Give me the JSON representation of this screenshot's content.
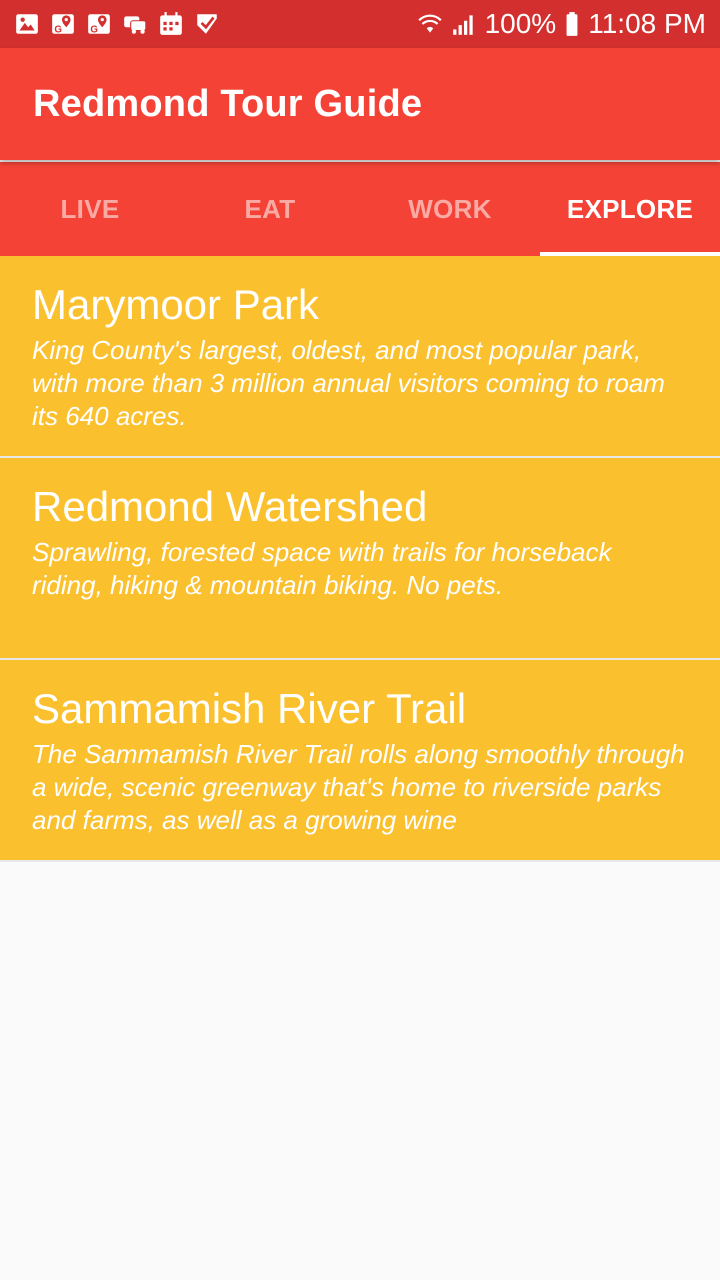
{
  "status_bar": {
    "icons_left": [
      "image-icon",
      "maps-icon",
      "maps-icon",
      "car-icon",
      "calendar-icon",
      "check-app-icon"
    ],
    "icons_right": [
      "wifi-icon",
      "signal-icon",
      "battery-icon"
    ],
    "battery": "100%",
    "time": "11:08 PM"
  },
  "app_bar": {
    "title": "Redmond Tour Guide"
  },
  "tabs": [
    {
      "label": "LIVE",
      "active": false
    },
    {
      "label": "EAT",
      "active": false
    },
    {
      "label": "WORK",
      "active": false
    },
    {
      "label": "EXPLORE",
      "active": true
    }
  ],
  "places": [
    {
      "title": "Marymoor Park",
      "description": "King County's largest, oldest, and most popular park, with more than 3 million annual visitors coming to roam its 640 acres."
    },
    {
      "title": "Redmond Watershed",
      "description": "Sprawling, forested space with trails for horseback riding, hiking & mountain biking. No pets."
    },
    {
      "title": "Sammamish River Trail",
      "description": "The Sammamish River Trail rolls along smoothly through a wide, scenic greenway that's home to riverside parks and farms, as well as a growing wine"
    }
  ],
  "colors": {
    "status_bar": "#d32f2f",
    "primary": "#f44336",
    "list_item": "#fbc02d",
    "background": "#fafafa"
  }
}
